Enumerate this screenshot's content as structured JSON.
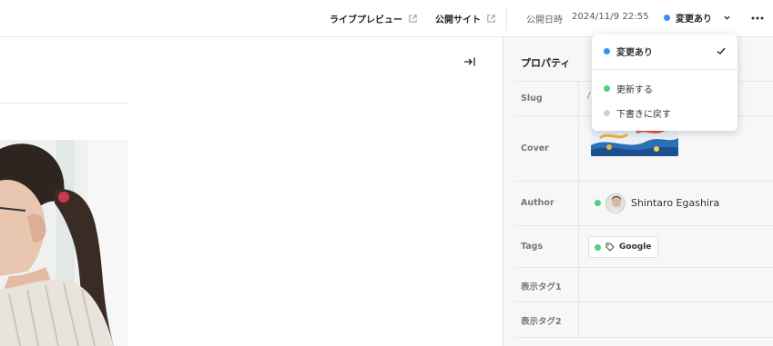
{
  "header": {
    "live_preview_label": "ライブプレビュー",
    "public_site_label": "公開サイト",
    "published_label": "公開日時",
    "published_datetime": "2024/11/9 22:55",
    "status_label": "変更あり",
    "status_color": "#3b8ff3",
    "icons": {
      "external": "external-link-icon",
      "chevron": "chevron-down-icon",
      "more": "more-horizontal-icon"
    }
  },
  "editor": {
    "collapse_icon": "collapse-right-icon",
    "image_description_icon": "photo-icon"
  },
  "properties": {
    "title": "プロパティ",
    "rows": [
      {
        "label": "Slug",
        "value": "/"
      },
      {
        "label": "Cover",
        "value": ""
      },
      {
        "label": "Author",
        "value": "Shintaro Egashira",
        "status_color": "#4fcf7f"
      },
      {
        "label": "Tags",
        "value": "Google",
        "status_color": "#4fcf7f"
      },
      {
        "label": "表示タグ1",
        "value": ""
      },
      {
        "label": "表示タグ2",
        "value": ""
      }
    ]
  },
  "status_menu": {
    "items": [
      {
        "label": "変更あり",
        "color": "#3b8ff3",
        "selected": true
      },
      {
        "label": "更新する",
        "color": "#4fcf7f",
        "selected": false
      },
      {
        "label": "下書きに戻す",
        "color": "#cfcfcf",
        "selected": false
      }
    ]
  }
}
